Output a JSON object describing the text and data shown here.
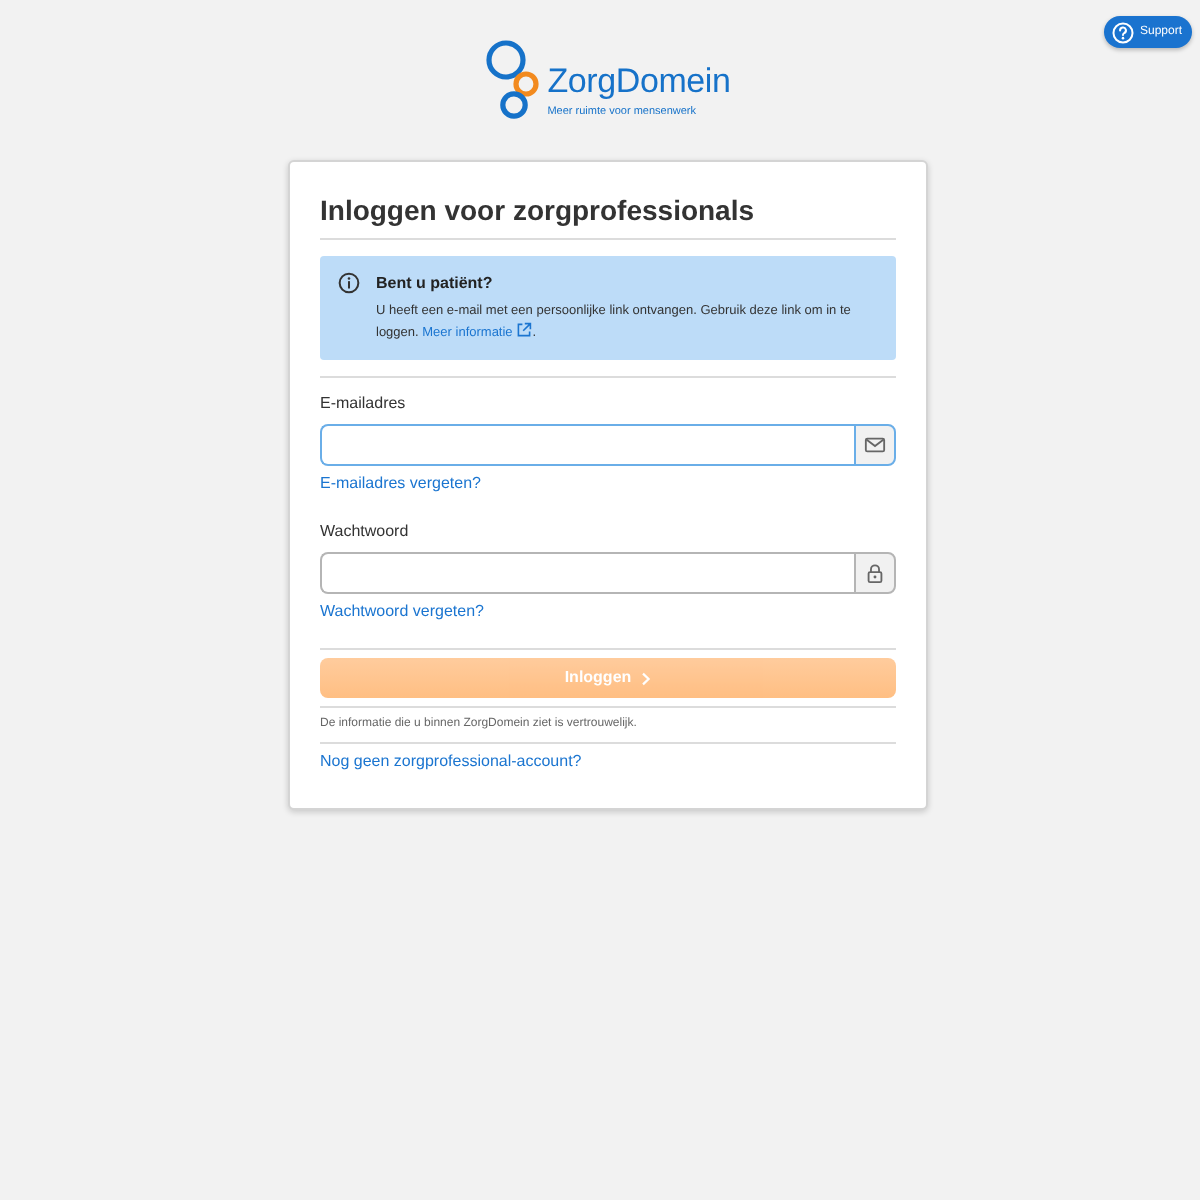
{
  "support_button": {
    "label": "Support"
  },
  "logo": {
    "name": "ZorgDomein",
    "tagline": "Meer ruimte voor mensenwerk"
  },
  "card": {
    "title": "Inloggen voor zorgprofessionals",
    "alert": {
      "title": "Bent u patiënt?",
      "text": "U heeft een e-mail met een persoonlijke link ontvangen. Gebruik deze link om in te loggen.",
      "link": "Meer informatie",
      "text_after": "."
    },
    "fields": [
      {
        "kind": "email",
        "label": "E-mailadres",
        "focused": true,
        "forgot_link": "E-mailadres vergeten?"
      },
      {
        "kind": "password",
        "label": "Wachtwoord",
        "focused": false,
        "forgot_link": "Wachtwoord vergeten?"
      }
    ],
    "submit": {
      "label": "Inloggen",
      "disabled": true
    },
    "notice": "De informatie die u binnen ZorgDomein ziet is vertrouwelijk.",
    "register_link": "Nog geen zorgprofessional-account?"
  }
}
